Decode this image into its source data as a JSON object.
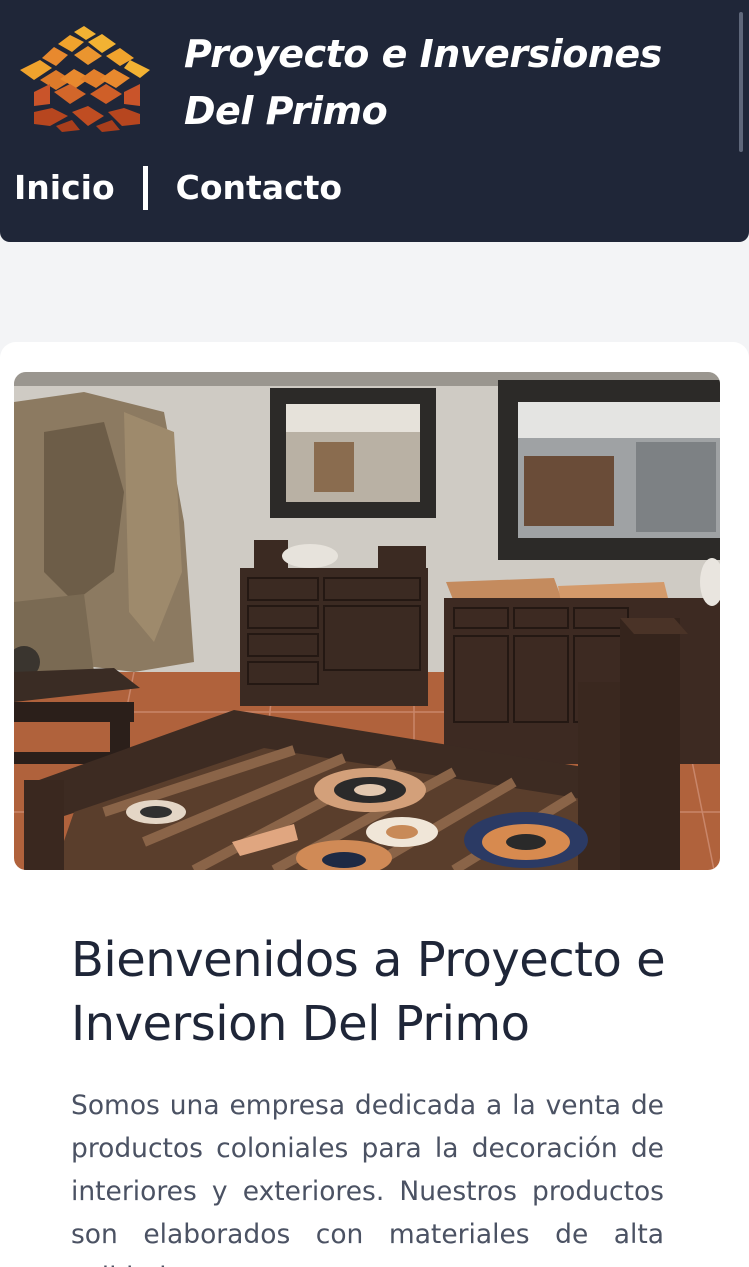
{
  "header": {
    "brand_line1": "Proyecto e Inversiones",
    "brand_line2": "Del Primo",
    "logo_icon": "tile-roof-logo-icon",
    "colors": {
      "background": "#1f2638",
      "text": "#ffffff",
      "logo_orange": "#e8892e",
      "logo_dark": "#b7461f"
    }
  },
  "nav": {
    "items": [
      {
        "label": "Inicio"
      },
      {
        "label": "Contacto"
      }
    ]
  },
  "hero": {
    "image_icon": "showroom-photo"
  },
  "main": {
    "title": "Bienvenidos a Proyecto e Inversion Del Primo",
    "description": "Somos una empresa dedicada a la venta de productos coloniales para la decoración de interiores y exteriores. Nuestros productos son elaborados con materiales de alta calidad"
  }
}
